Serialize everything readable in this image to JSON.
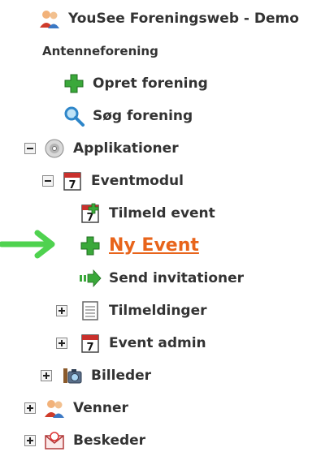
{
  "tree": {
    "root": {
      "label": "YouSee Foreningsweb - Demo",
      "icon": "users-icon"
    },
    "section": {
      "label": "Antenneforening"
    },
    "opret": {
      "label": "Opret forening",
      "icon": "green-plus-icon"
    },
    "sog": {
      "label": "Søg forening",
      "icon": "magnifier-icon"
    },
    "applikationer": {
      "label": "Applikationer",
      "icon": "cd-icon",
      "expanded": true
    },
    "eventmodul": {
      "label": "Eventmodul",
      "icon": "calendar-icon",
      "expanded": true
    },
    "tilmeld": {
      "label": "Tilmeld event",
      "icon": "calendar-plus-icon"
    },
    "nyevent": {
      "label": "Ny Event",
      "icon": "green-plus-icon",
      "highlighted": true,
      "color": "#e8641b"
    },
    "send": {
      "label": "Send invitationer",
      "icon": "send-arrow-icon"
    },
    "tilmeldinger": {
      "label": "Tilmeldinger",
      "icon": "list-icon",
      "expanded": false
    },
    "eventadmin": {
      "label": "Event admin",
      "icon": "calendar-icon",
      "expanded": false
    },
    "billeder": {
      "label": "Billeder",
      "icon": "camera-icon",
      "expanded": false
    },
    "venner": {
      "label": "Venner",
      "icon": "users-icon",
      "expanded": false
    },
    "beskeder": {
      "label": "Beskeder",
      "icon": "envelope-icon",
      "expanded": false
    }
  },
  "annotation": {
    "arrow_color": "#4fd24f"
  }
}
